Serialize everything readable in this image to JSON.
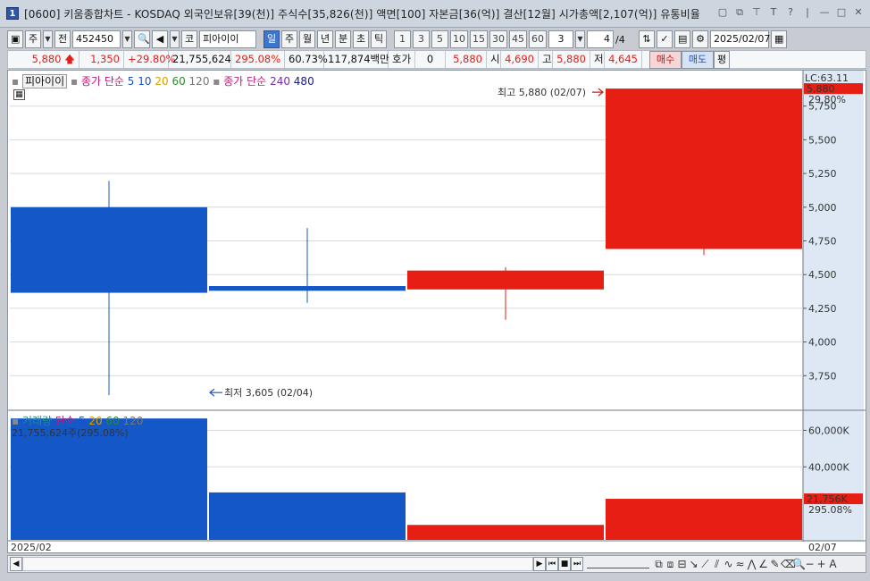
{
  "window": {
    "number": "1",
    "title": "[0600] 키움종합차트 - KOSDAQ 외국인보유[39(천)] 주식수[35,826(천)] 액면[100] 자본금[36(억)] 결산[12월] 시가총액[2,107(억)] 유통비율"
  },
  "toolbar": {
    "chart_type": "주",
    "prev": "전",
    "stock_code": "452450",
    "market": "코",
    "stock_name": "피아이이",
    "periods": [
      "일",
      "주",
      "월",
      "년",
      "분",
      "초",
      "틱"
    ],
    "selected_period": "일",
    "intervals": [
      "1",
      "3",
      "5",
      "10",
      "15",
      "30",
      "45",
      "60"
    ],
    "count": "3",
    "page": "4",
    "page_total": "/4",
    "date": "2025/02/07"
  },
  "price_info": {
    "price": "5,880",
    "change": "1,350",
    "change_pct": "+29.80%",
    "volume": "21,755,624",
    "volume_ratio": "295.08%",
    "turnover": "60.73%",
    "amount": "117,874백만",
    "quote_label": "호가",
    "quote_value": "0",
    "quote_price": "5,880",
    "open_label": "시",
    "open": "4,690",
    "high_label": "고",
    "high": "5,880",
    "low_label": "저",
    "low": "4,645",
    "buy": "매수",
    "sell": "매도",
    "avg": "평"
  },
  "legend": {
    "name": "피아이이",
    "close_simple": "종가 단순",
    "ma": [
      "5",
      "10",
      "20",
      "60",
      "120"
    ],
    "close_simple2": "종가 단순",
    "ma2": [
      "240",
      "480"
    ],
    "ma_colors": [
      "#1f4fc0",
      "#1f4fc0",
      "#d6a000",
      "#2b8a2b",
      "#777777"
    ],
    "volume_label": "거래량",
    "volume_simple": "단순",
    "vol_ma": [
      "5",
      "20",
      "60",
      "120"
    ],
    "volume_info": "21,755,624주(295.08%)"
  },
  "annotations": {
    "high": "최고 5,880 (02/07)",
    "low": "최저 3,605 (02/04)",
    "lc": "LC:63.11",
    "last_price": "5,880",
    "last_pct": "29.80%",
    "last_vol": "21,756K",
    "last_vol_pct": "295.08%",
    "x_start": "2025/02",
    "x_end": "02/07"
  },
  "chart_data": {
    "type": "candlestick",
    "price_ylim": [
      3500,
      6000
    ],
    "price_ticks": [
      "5,750",
      "5,500",
      "5,250",
      "5,000",
      "4,750",
      "4,500",
      "4,250",
      "4,000",
      "3,750"
    ],
    "price_tick_values": [
      5750,
      5500,
      5250,
      5000,
      4750,
      4500,
      4250,
      4000,
      3750
    ],
    "candles": [
      {
        "open": 5000,
        "high": 5195,
        "low": 3605,
        "close": 4365,
        "color": "#1458c8"
      },
      {
        "open": 4415,
        "high": 4845,
        "low": 4290,
        "close": 4380,
        "color": "#1458c8"
      },
      {
        "open": 4390,
        "high": 4555,
        "low": 4165,
        "close": 4530,
        "color": "#e61e13"
      },
      {
        "open": 4690,
        "high": 5880,
        "low": 4645,
        "close": 5880,
        "color": "#e61e13"
      }
    ],
    "volume_ylim": [
      0,
      70000
    ],
    "volume_ticks": [
      "60,000K",
      "40,000K"
    ],
    "volume_tick_values": [
      60000,
      40000
    ],
    "volumes": [
      66500,
      26000,
      8200,
      22500
    ],
    "volume_colors": [
      "#1458c8",
      "#1458c8",
      "#e61e13",
      "#e61e13"
    ]
  }
}
